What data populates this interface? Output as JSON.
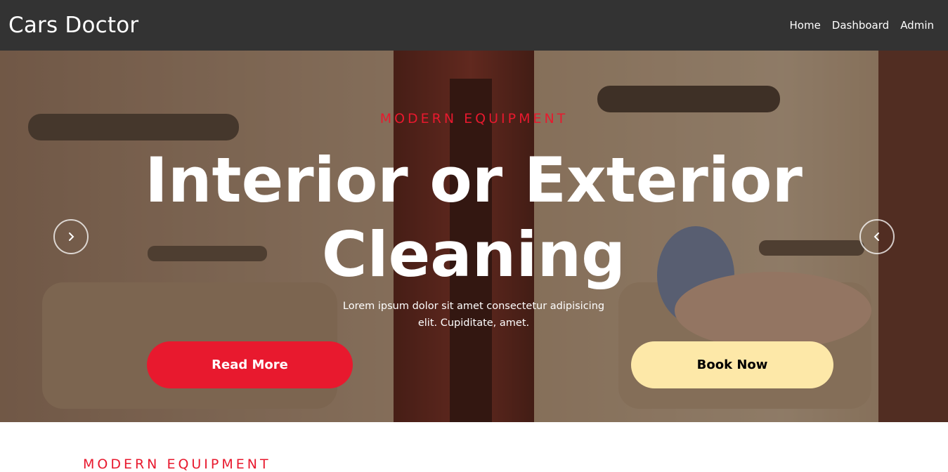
{
  "navbar": {
    "brand": "Cars Doctor",
    "links": [
      {
        "label": "Home"
      },
      {
        "label": "Dashboard"
      },
      {
        "label": "Admin"
      }
    ]
  },
  "hero": {
    "eyebrow": "MODERN EQUIPMENT",
    "title": "Interior or Exterior Cleaning",
    "description": "Lorem ipsum dolor sit amet consectetur adipisicing elit. Cupiditate, amet.",
    "primary_button": "Read More",
    "secondary_button": "Book Now",
    "carousel_prev_icon": "chevron-right-icon",
    "carousel_next_icon": "chevron-left-icon"
  },
  "next_section": {
    "eyebrow": "MODERN EQUIPMENT"
  },
  "colors": {
    "navbar_bg": "#333333",
    "accent_red": "#e8192e",
    "book_button_bg": "#fde8a8"
  }
}
